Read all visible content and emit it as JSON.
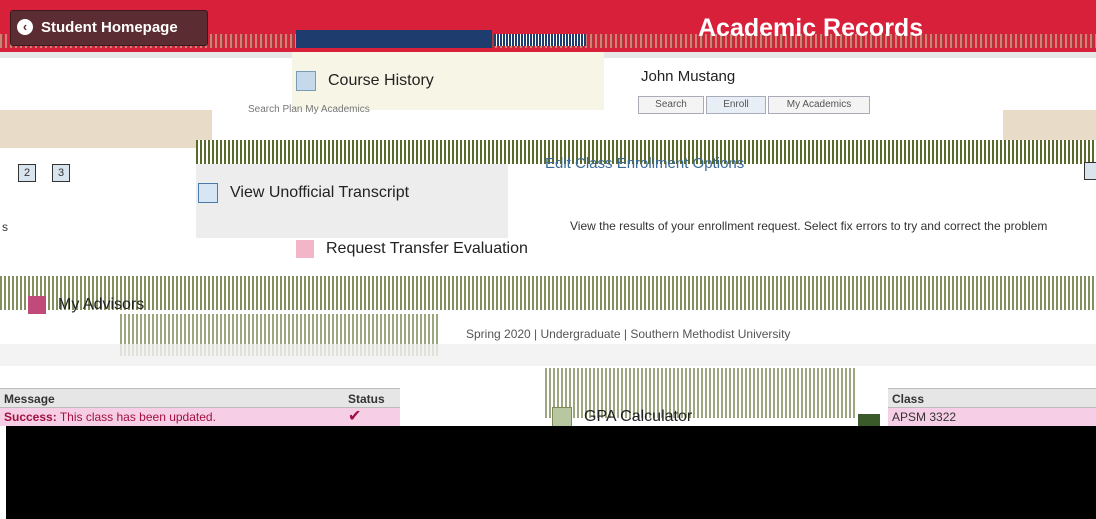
{
  "header": {
    "home_button": "Student Homepage",
    "home_chevron": "‹",
    "title": "Academic Records"
  },
  "menu": {
    "course_history": "Course History",
    "unofficial_transcript": "View Unofficial Transcript",
    "transfer_evaluation": "Request Transfer Evaluation",
    "my_advisors": "My Advisors",
    "gpa_calculator": "GPA Calculator"
  },
  "user": {
    "name": "John Mustang",
    "tabs": [
      "Search",
      "Enroll",
      "My Academics"
    ],
    "old_tabs": "Search   Plan   My Academics"
  },
  "pager": [
    "2",
    "3"
  ],
  "enrollment": {
    "edit_options": "Edit Class Enrollment Options",
    "results_message": "View the results of your enrollment request.  Select fix errors to try and correct the problem",
    "term": "Spring 2020 | Undergraduate | Southern Methodist University",
    "cut_letter": "s"
  },
  "results_table": {
    "headers": {
      "message": "Message",
      "status": "Status",
      "class": "Class"
    },
    "row": {
      "message_prefix": "Success:",
      "message_text": " This class has been updated.",
      "status": "✔",
      "class": "APSM 3322"
    }
  },
  "colors": {
    "header_red": "#d8203a",
    "home_button": "#5b2c32",
    "link_blue": "#3b6a97",
    "success_row": "#f6cfe6"
  }
}
